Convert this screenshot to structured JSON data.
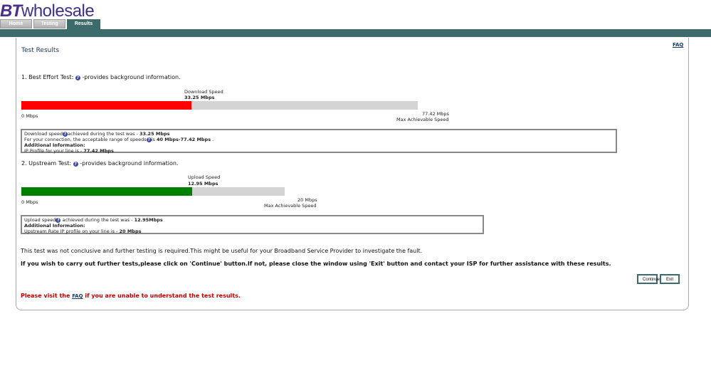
{
  "header": {
    "logo_bt": "BT",
    "logo_wholesale": "wholesale",
    "tabs": [
      {
        "label": "Home"
      },
      {
        "label": "Testing"
      },
      {
        "label": "Results"
      }
    ],
    "accent_color": "#3d6b6b"
  },
  "page": {
    "faq_link": "FAQ",
    "title": "Test Results"
  },
  "best_effort": {
    "heading_prefix": "1. Best Effort Test:",
    "heading_suffix": "-provides background information.",
    "bar_title": "Download Speed",
    "bar_value": "33.25 Mbps",
    "min_label": "0 Mbps",
    "max_label": "77.42 Mbps",
    "max_caption": "Max Achievable Speed",
    "fraction": 0.4295,
    "fill_color": "#ff0000",
    "box": {
      "line1_pre": "Download speed",
      "line1_mid": "achieved during the test was - ",
      "line1_val": "33.25 Mbps",
      "line2_pre": "For your connection, the acceptable range of speeds",
      "line2_mid": "is ",
      "line2_val": "40 Mbps-77.42 Mbps",
      "line2_end": " .",
      "line3": "Additional Information:",
      "line4_pre": "IP Profile for your line is - ",
      "line4_val": "77.42 Mbps"
    }
  },
  "upstream": {
    "heading_prefix": "2. Upstream Test:",
    "heading_suffix": "-provides background information.",
    "bar_title": "Upload Speed",
    "bar_value": "12.95 Mbps",
    "min_label": "0 Mbps",
    "max_label": "20 Mbps",
    "max_caption": "Max Achievable Speed",
    "fraction": 0.6475,
    "fill_color": "#008000",
    "box": {
      "line1_pre": "Upload speed",
      "line1_mid": " achieved during the test was - ",
      "line1_val": "12.95Mbps",
      "line2": "Additional Information:",
      "line3_pre": "Upstream Rate IP profile on your line is - ",
      "line3_val": "20 Mbps"
    }
  },
  "notes": {
    "inconclusive": "This test was not conclusive and further testing is required.This might be useful for your Broadband Service Provider to investigate the fault.",
    "instructions": "If you wish to carry out further tests,please click on 'Continue' button.If not, please close the window using 'Exit' button and contact your ISP for further assistance with these results.",
    "warn_pre": "Please visit the ",
    "warn_link": "FAQ",
    "warn_post": " if you are unable to understand the test results."
  },
  "buttons": {
    "continue": "Continue",
    "exit": "Exit"
  }
}
